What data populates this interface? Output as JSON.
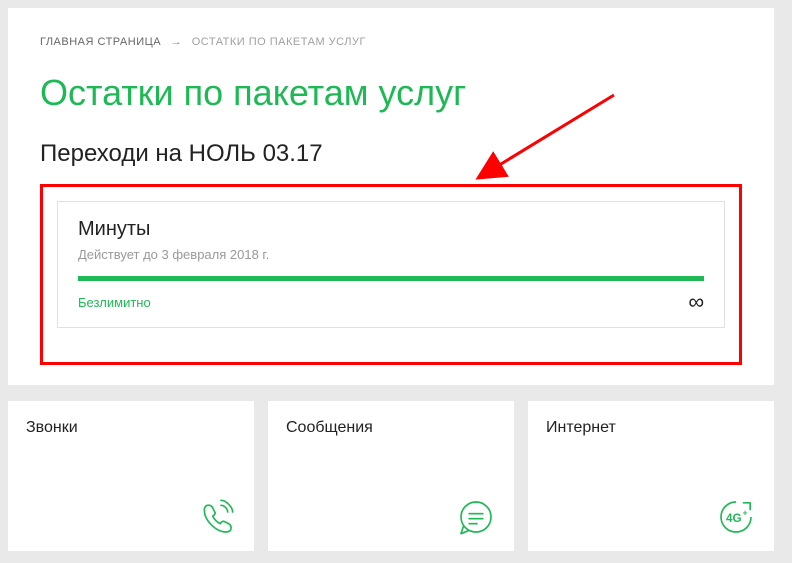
{
  "breadcrumb": {
    "home": "ГЛАВНАЯ СТРАНИЦА",
    "arrow": "→",
    "current": "ОСТАТКИ ПО ПАКЕТАМ УСЛУГ"
  },
  "page_title": "Остатки по пакетам услуг",
  "plan_name": "Переходи на НОЛЬ 03.17",
  "package": {
    "title": "Минуты",
    "valid_until": "Действует до 3 февраля 2018 г.",
    "status": "Безлимитно",
    "infinity": "∞"
  },
  "services": [
    {
      "label": "Звонки",
      "icon": "calls"
    },
    {
      "label": "Сообщения",
      "icon": "messages"
    },
    {
      "label": "Интернет",
      "icon": "internet"
    }
  ]
}
